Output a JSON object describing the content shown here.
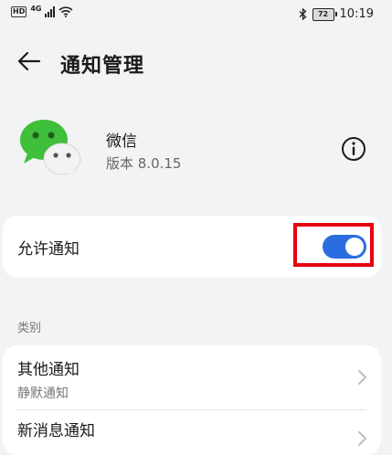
{
  "status_bar": {
    "hd": "HD",
    "network": "4G",
    "battery": "72",
    "time": "10:19"
  },
  "header": {
    "title": "通知管理",
    "back_icon": "back-arrow-icon"
  },
  "app": {
    "name": "微信",
    "version": "版本 8.0.15",
    "icon": "wechat-icon",
    "info_icon": "info-icon"
  },
  "allow": {
    "label": "允许通知",
    "enabled": true,
    "accent": "#2b6de0",
    "highlight_color": "#e60012"
  },
  "category": {
    "section_label": "类别",
    "items": [
      {
        "title": "其他通知",
        "subtitle": "静默通知"
      },
      {
        "title": "新消息通知",
        "subtitle": ""
      }
    ]
  }
}
